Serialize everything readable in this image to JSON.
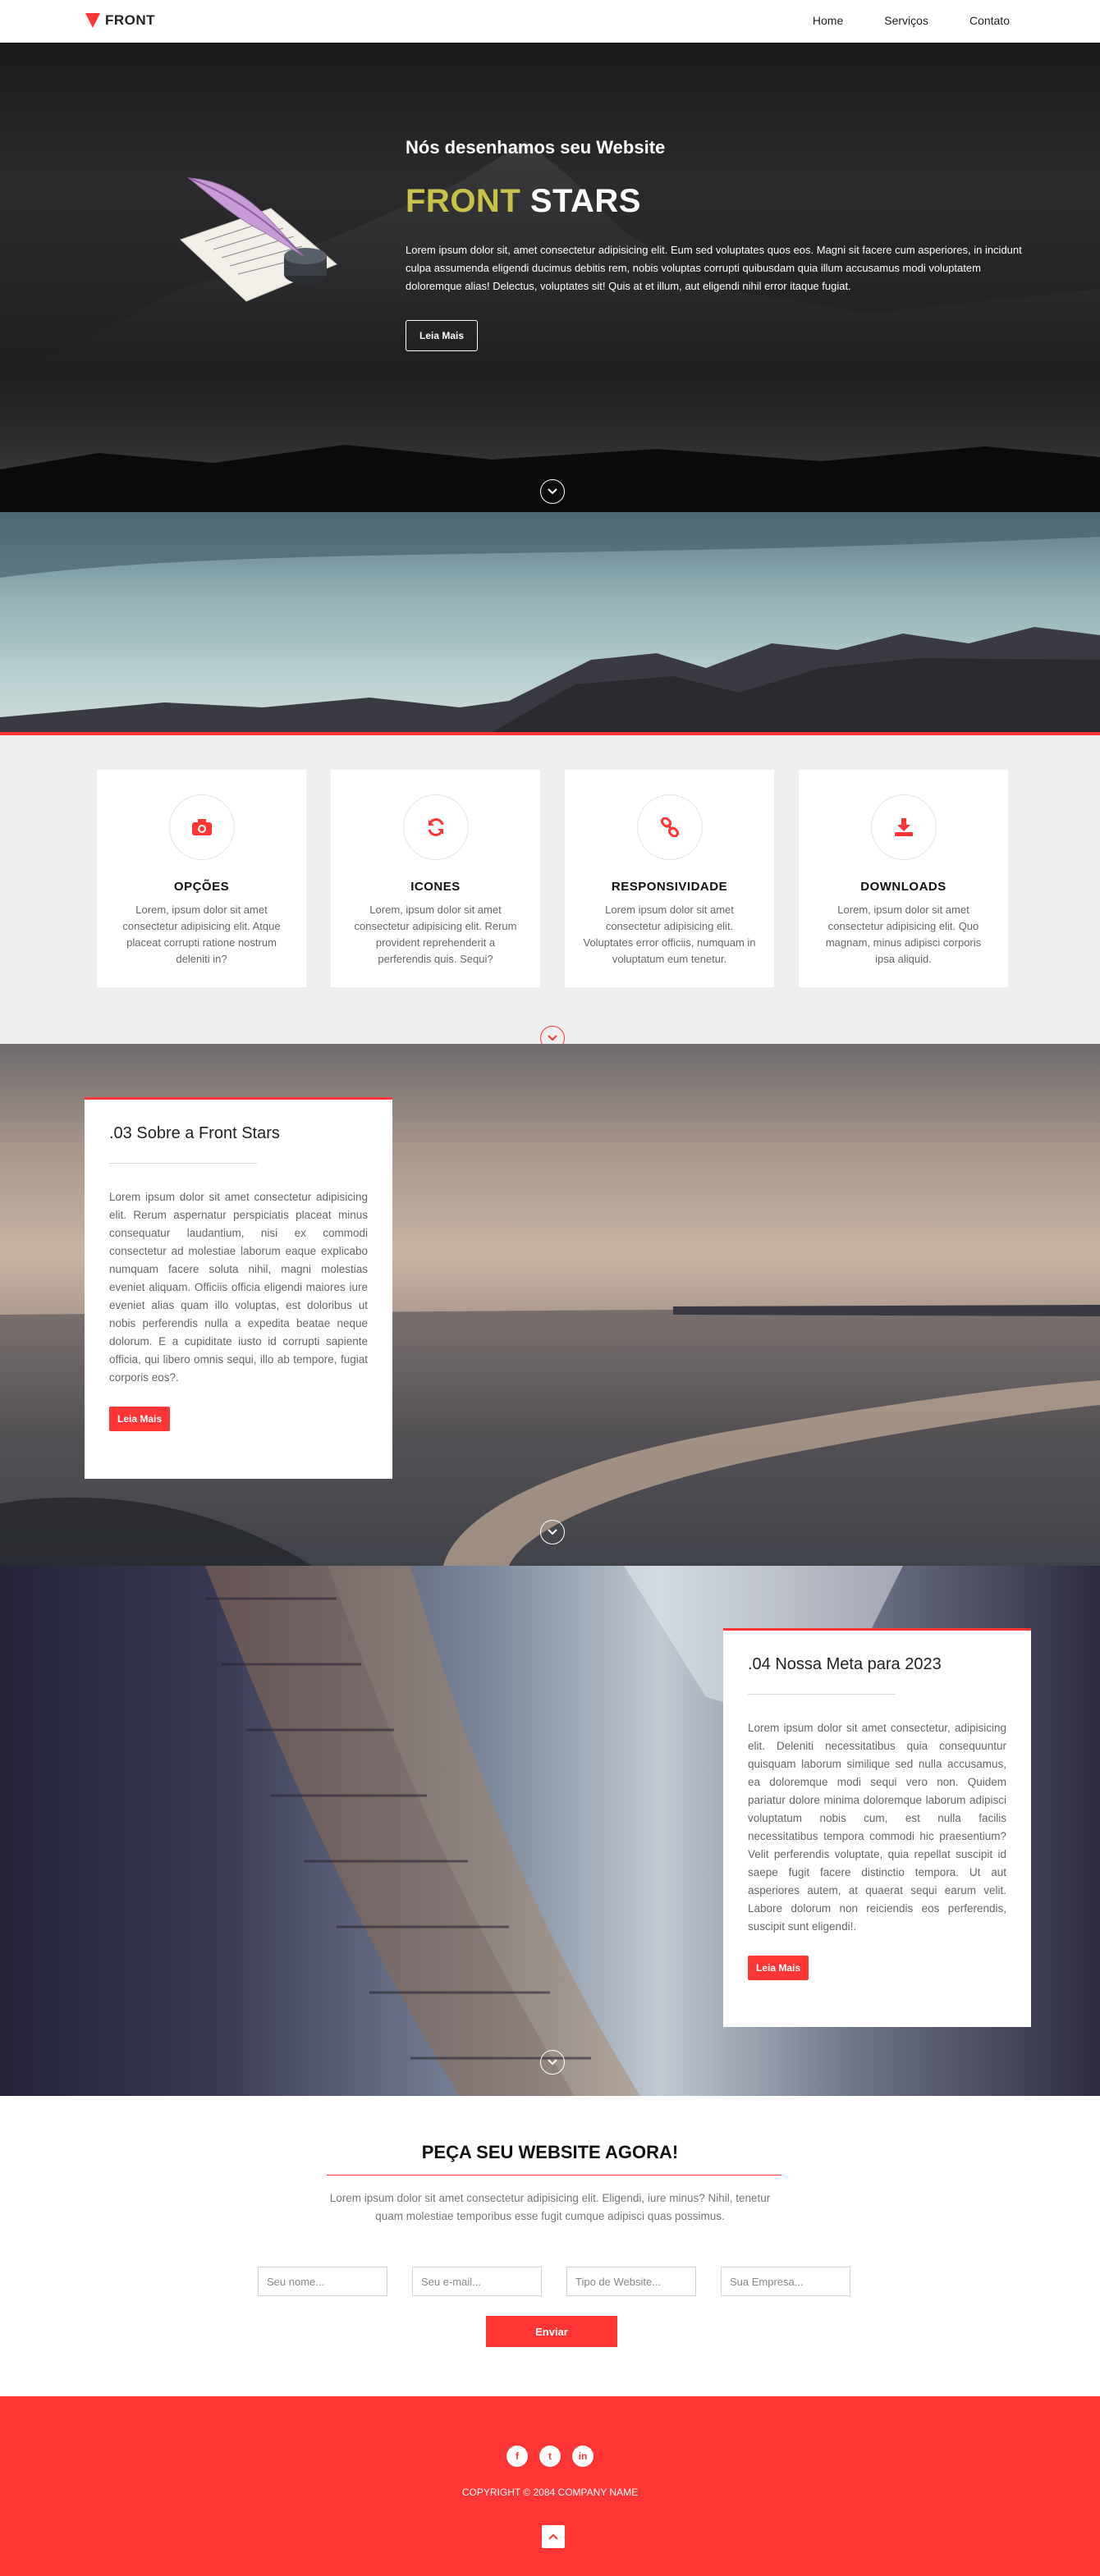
{
  "nav": {
    "logo": "FRONT",
    "items": [
      {
        "label": "Home"
      },
      {
        "label": "Serviços"
      },
      {
        "label": "Contato"
      }
    ]
  },
  "hero": {
    "subtitle": "Nós desenhamos seu Website",
    "title_accent": "FRONT",
    "title_rest": " STARS",
    "text": "Lorem ipsum dolor sit, amet consectetur adipisicing elit. Eum sed voluptates quos eos. Magni sit facere cum asperiores, in incidunt culpa assumenda eligendi ducimus debitis rem, nobis voluptas corrupti quibusdam quia illum accusamus modi voluptatem doloremque alias! Delectus, voluptates sit! Quis at et illum, aut eligendi nihil error itaque fugiat.",
    "button": "Leia Mais"
  },
  "features": [
    {
      "icon": "camera-icon",
      "title": "OPÇÕES",
      "text": "Lorem, ipsum dolor sit amet consectetur adipisicing elit. Atque placeat corrupti ratione nostrum deleniti in?"
    },
    {
      "icon": "refresh-icon",
      "title": "ICONES",
      "text": "Lorem, ipsum dolor sit amet consectetur adipisicing elit. Rerum provident reprehenderit a perferendis quis. Sequi?"
    },
    {
      "icon": "link-icon",
      "title": "RESPONSIVIDADE",
      "text": "Lorem ipsum dolor sit amet consectetur adipisicing elit. Voluptates error officiis, numquam in voluptatum eum tenetur."
    },
    {
      "icon": "download-icon",
      "title": "DOWNLOADS",
      "text": "Lorem, ipsum dolor sit amet consectetur adipisicing elit. Quo magnam, minus adipisci corporis ipsa aliquid."
    }
  ],
  "about": {
    "title": ".03 Sobre a Front Stars",
    "text": "Lorem ipsum dolor sit amet consectetur adipisicing elit. Rerum aspernatur perspiciatis placeat minus consequatur laudantium, nisi ex commodi consectetur ad molestiae laborum eaque explicabo numquam facere soluta nihil, magni molestias eveniet aliquam. Officiis officia eligendi maiores iure eveniet alias quam illo voluptas, est doloribus ut nobis perferendis nulla a expedita beatae neque dolorum. E a cupiditate iusto id corrupti sapiente officia, qui libero omnis sequi, illo ab tempore, fugiat corporis eos?.",
    "button": "Leia Mais"
  },
  "goal": {
    "title": ".04 Nossa Meta para 2023",
    "text": "Lorem ipsum dolor sit amet consectetur, adipisicing elit. Deleniti necessitatibus quia consequuntur quisquam laborum similique sed nulla accusamus, ea doloremque modi sequi vero non. Quidem pariatur dolore minima doloremque laborum adipisci voluptatum nobis cum, est nulla facilis necessitatibus tempora commodi hic praesentium? Velit perferendis voluptate, quia repellat suscipit id saepe fugit facere distinctio tempora. Ut aut asperiores autem, at quaerat sequi earum velit. Labore dolorum non reiciendis eos perferendis, suscipit sunt eligendi!.",
    "button": "Leia Mais"
  },
  "contact": {
    "title": "PEÇA SEU WEBSITE AGORA!",
    "text": "Lorem ipsum dolor sit amet consectetur adipisicing elit. Eligendi, iure minus? Nihil, tenetur quam molestiae temporibus esse fugit cumque adipisci quas possimus.",
    "placeholders": {
      "name": "Seu nome...",
      "email": "Seu e-mail...",
      "type": "Tipo de Website...",
      "company": "Sua Empresa..."
    },
    "button": "Enviar"
  },
  "footer": {
    "social": [
      {
        "icon": "facebook-icon",
        "glyph": "f"
      },
      {
        "icon": "twitter-icon",
        "glyph": "t"
      },
      {
        "icon": "linkedin-icon",
        "glyph": "in"
      }
    ],
    "copyright": "COPYRIGHT © 2084 COMPANY NAME"
  },
  "colors": {
    "accent": "#fd3535",
    "hero_accent": "#c8c24a",
    "section_bg": "#eeeeee"
  }
}
